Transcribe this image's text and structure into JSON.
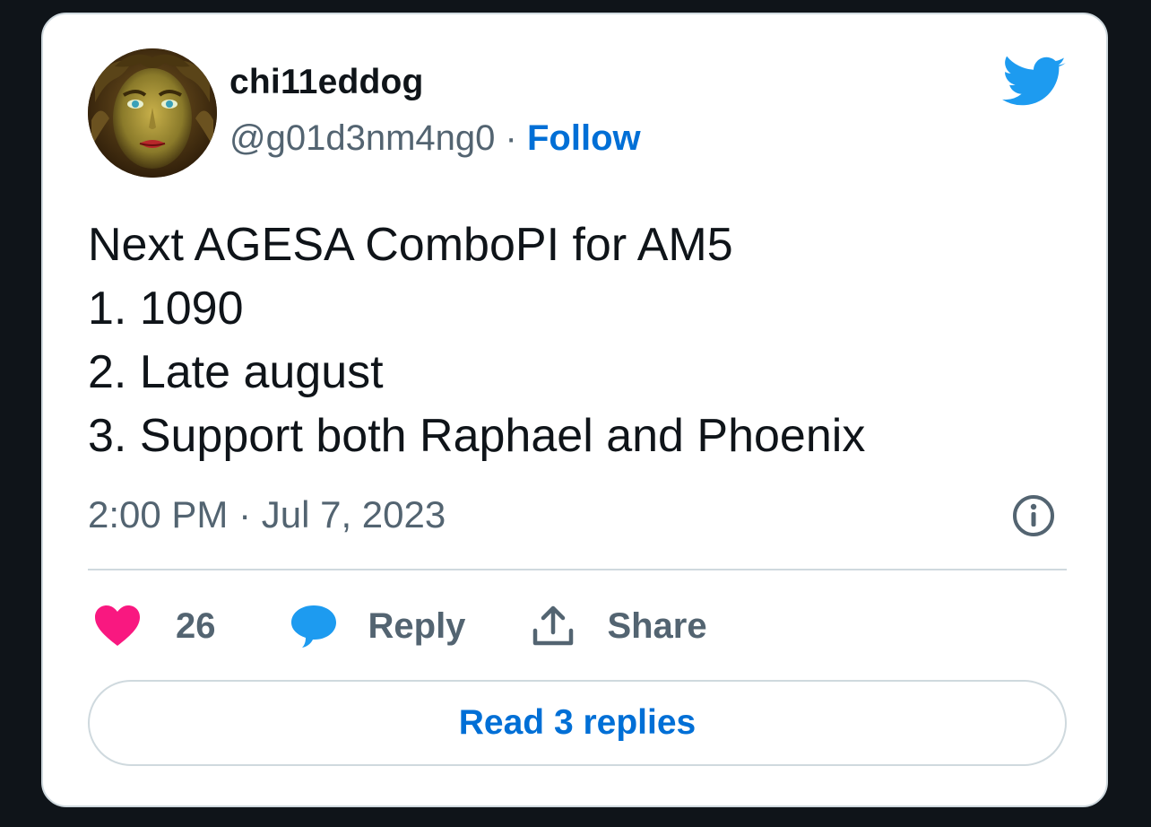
{
  "author": {
    "display_name": "chi11eddog",
    "handle": "@g01d3nm4ng0",
    "separator": "·",
    "follow_label": "Follow"
  },
  "tweet": {
    "lines": [
      "Next AGESA ComboPI for AM5",
      "1. 1090",
      "2. Late august",
      "3. Support both Raphael and Phoenix"
    ],
    "timestamp": "2:00 PM · Jul 7, 2023"
  },
  "actions": {
    "like_count": "26",
    "reply_label": "Reply",
    "share_label": "Share"
  },
  "read_replies_label": "Read 3 replies",
  "colors": {
    "brand_blue": "#1d9bf0",
    "link_blue": "#006fd6",
    "like_pink": "#f91880",
    "muted_text": "#536471",
    "border": "#cfd9de"
  },
  "icons": {
    "brand": "twitter-bird-icon",
    "info": "info-icon",
    "like": "heart-icon",
    "reply": "speech-bubble-icon",
    "share": "share-upload-icon"
  }
}
